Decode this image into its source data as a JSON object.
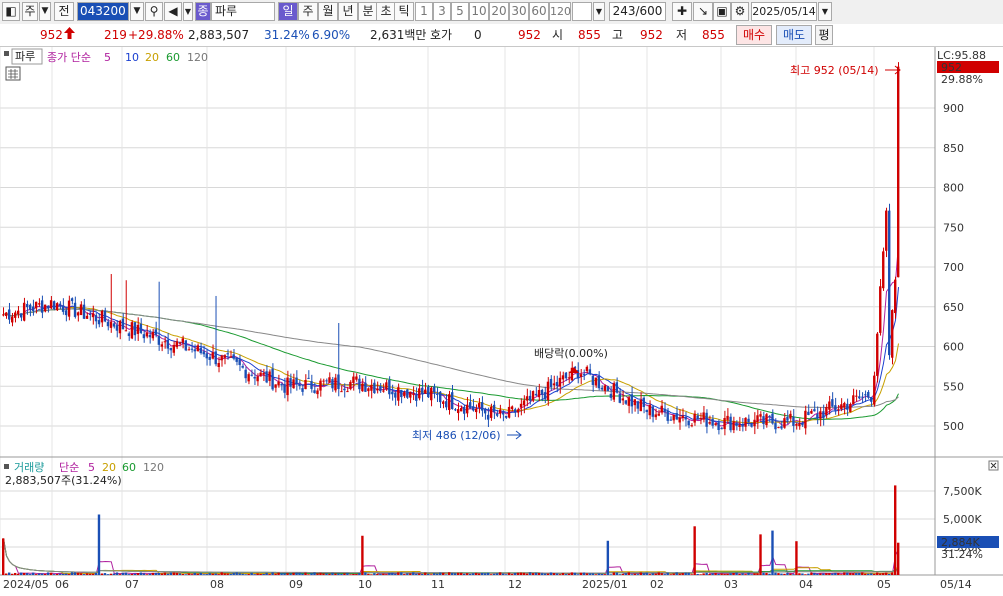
{
  "toolbar": {
    "market": "주",
    "prev": "전",
    "code": "043200",
    "type_badge": "종",
    "name": "파루",
    "periods": [
      "일",
      "주",
      "월",
      "년",
      "분",
      "초",
      "틱"
    ],
    "active_period": "일",
    "intervals": [
      "1",
      "3",
      "5",
      "10",
      "20",
      "30",
      "60",
      "120"
    ],
    "count": "243/600",
    "date": "2025/05/14"
  },
  "quote": {
    "price": "952",
    "change": "219",
    "change_pct": "+29.88%",
    "volume": "2,883,507",
    "volume_ratio": "31.24%",
    "turnover": "6.90%",
    "amount": "2,631백만",
    "hoga_label": "호가",
    "hoga_value": "0",
    "ask": "952",
    "open_label": "시",
    "open": "855",
    "high_label": "고",
    "high": "952",
    "low_label": "저",
    "low": "855",
    "buy": "매수",
    "sell": "매도",
    "eval": "평"
  },
  "price_panel": {
    "tab": "파루",
    "legend": [
      {
        "text": "종가 단순",
        "color": "#b0209e"
      },
      {
        "text": "5",
        "color": "#b0209e"
      },
      {
        "text": "10",
        "color": "#1a3fd0"
      },
      {
        "text": "20",
        "color": "#c8a000"
      },
      {
        "text": "60",
        "color": "#1a9a30"
      },
      {
        "text": "120",
        "color": "#777777"
      }
    ],
    "lc_label": "LC:95.88",
    "last_price_tag": "952",
    "last_pct_tag": "29.88%",
    "high_note": "최고 952 (05/14)",
    "low_note": "최저 486 (12/06)",
    "dividend_note": "배당락(0.00%)"
  },
  "volume_panel": {
    "legend": [
      {
        "text": "거래량",
        "color": "#1a9a9a"
      },
      {
        "text": "단순",
        "color": "#b0209e"
      },
      {
        "text": "5",
        "color": "#b0209e"
      },
      {
        "text": "20",
        "color": "#c8a000"
      },
      {
        "text": "60",
        "color": "#1a9a30"
      },
      {
        "text": "120",
        "color": "#777777"
      }
    ],
    "current": "2,883,507주(31.24%)",
    "last_vol_tag": "2,884K",
    "last_pct_tag": "31.24%"
  },
  "x_axis_labels": [
    "2024/05",
    "06",
    "07",
    "08",
    "09",
    "10",
    "11",
    "12",
    "2025/01",
    "02",
    "03",
    "04",
    "05",
    "05/14"
  ],
  "colors": {
    "up": "#d00000",
    "down": "#1a4fb5"
  },
  "chart_data": [
    {
      "type": "candlestick",
      "yticks": [
        500,
        550,
        600,
        650,
        700,
        750,
        800,
        850,
        900
      ],
      "ylim": [
        470,
        965
      ],
      "months": [
        "2024/05",
        "06",
        "07",
        "08",
        "09",
        "10",
        "11",
        "12",
        "2025/01",
        "02",
        "03",
        "04",
        "05"
      ],
      "key_points": [
        {
          "label": "2024/05",
          "close": 640
        },
        {
          "label": "06",
          "close": 655
        },
        {
          "label": "07",
          "close": 625
        },
        {
          "label": "08",
          "close": 590
        },
        {
          "label": "09",
          "close": 550
        },
        {
          "label": "10",
          "close": 555
        },
        {
          "label": "11",
          "close": 540
        },
        {
          "label": "12",
          "close": 510
        },
        {
          "label": "2025/01",
          "close": 570
        },
        {
          "label": "02",
          "close": 520
        },
        {
          "label": "03",
          "close": 505
        },
        {
          "label": "04",
          "close": 505
        },
        {
          "label": "05",
          "close": 540
        },
        {
          "label": "05/14",
          "close": 952
        }
      ],
      "high": 952,
      "low": 486
    },
    {
      "type": "bar",
      "name": "거래량",
      "yticks": [
        2500000,
        5000000,
        7500000
      ],
      "ytick_labels": [
        "2,500K",
        "5,000K",
        "7,500K"
      ],
      "ylim": [
        0,
        9000000
      ]
    }
  ]
}
